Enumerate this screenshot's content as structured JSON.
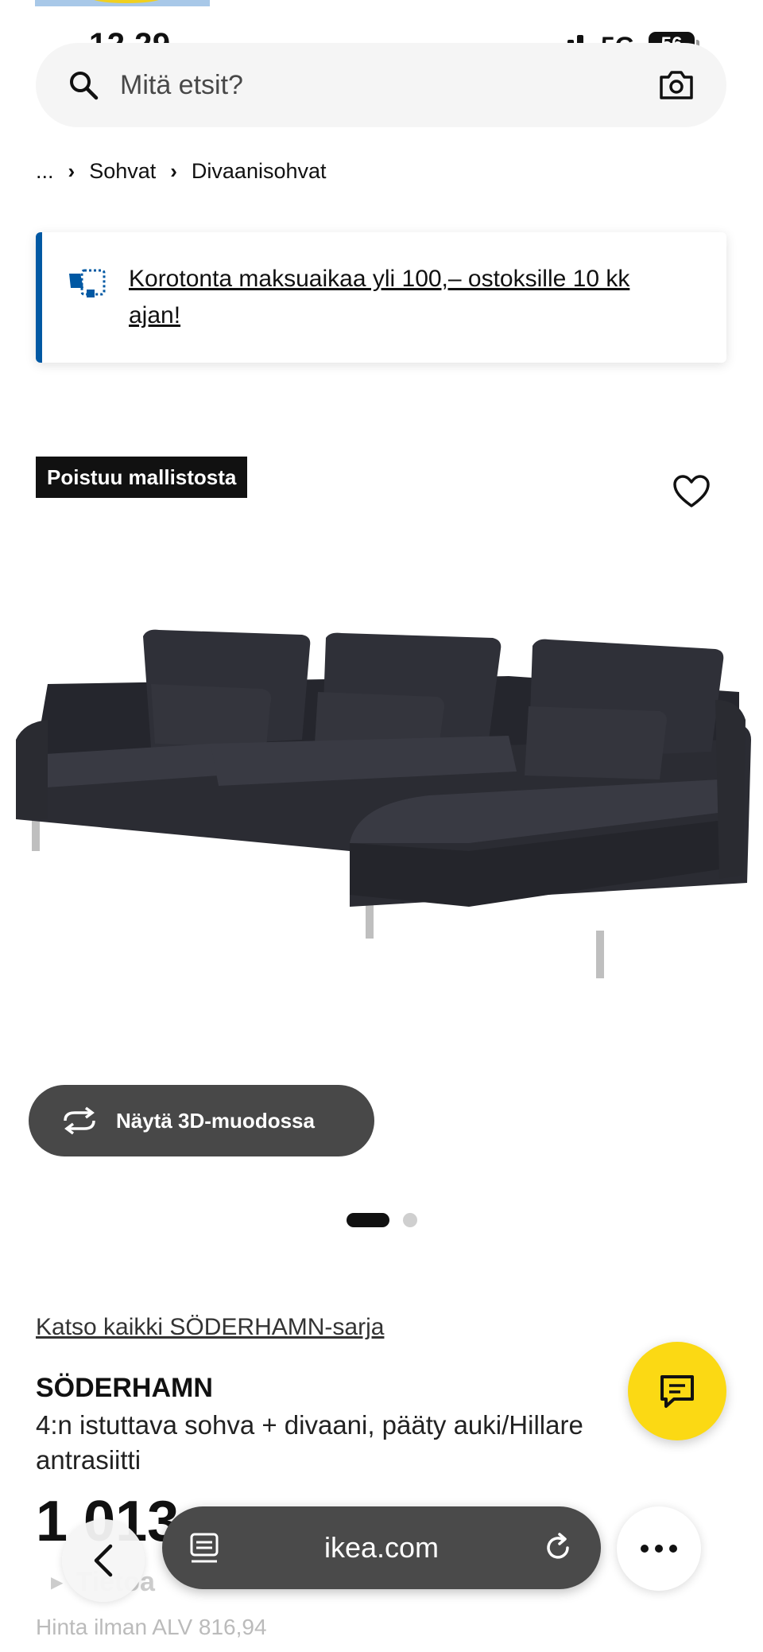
{
  "status_bar": {
    "time": "12.29",
    "network": "5G",
    "battery": "56"
  },
  "search": {
    "placeholder": "Mitä etsit?"
  },
  "breadcrumb": {
    "ellipsis": "...",
    "items": [
      "Sohvat",
      "Divaanisohvat"
    ]
  },
  "promo": {
    "text": "Korotonta maksuaikaa yli 100,– ostoksille 10 kk ajan!"
  },
  "product": {
    "badge": "Poistuu mallistosta",
    "view_3d_label": "Näytä 3D-muodossa",
    "series_link": "Katso kaikki SÖDERHAMN-sarja",
    "name": "SÖDERHAMN",
    "description": "4:n istuttava sohva + divaani, pääty auki/Hillare antrasiitti",
    "price": "1 013",
    "collapsible_label": "Tietoa",
    "vat_note": "Hinta ilman ALV 816,94",
    "image_count": 2,
    "active_image": 1
  },
  "browser": {
    "domain": "ikea.com"
  },
  "colors": {
    "brand_blue": "#0058a3",
    "ikea_yellow": "#fbd914",
    "badge_bg": "#111111",
    "dark_button": "#484848"
  }
}
